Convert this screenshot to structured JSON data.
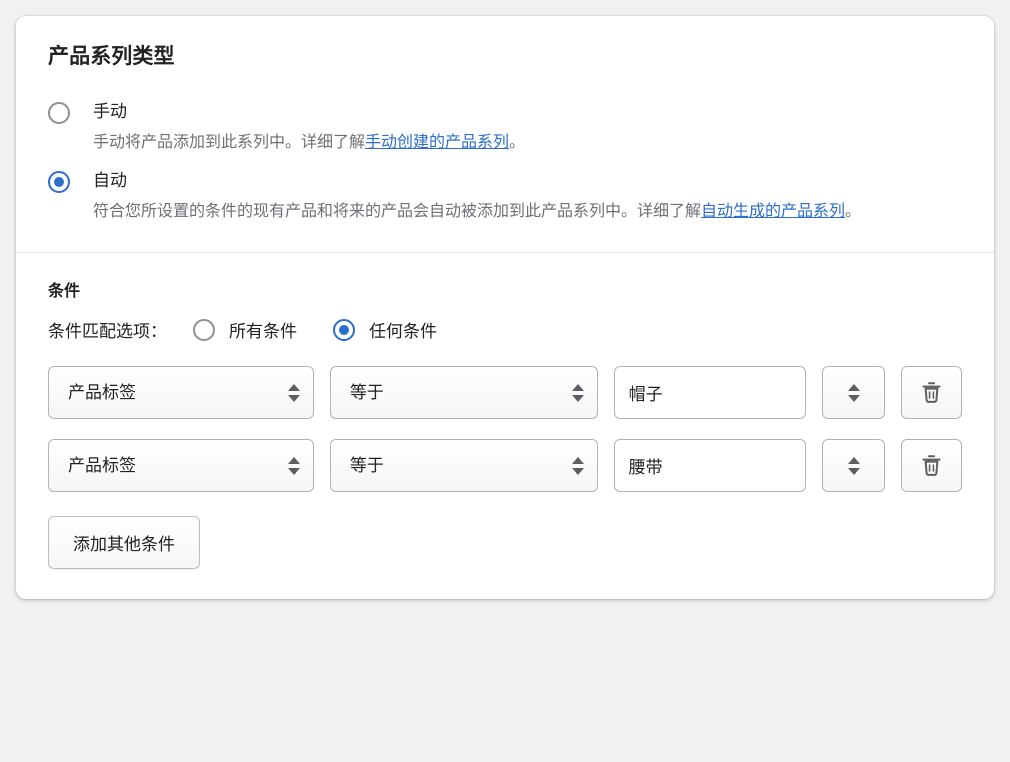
{
  "collection_type": {
    "title": "产品系列类型",
    "options": [
      {
        "label": "手动",
        "selected": false,
        "help_prefix": "手动将产品添加到此系列中。详细了解",
        "help_link": "手动创建的产品系列",
        "help_suffix": "。"
      },
      {
        "label": "自动",
        "selected": true,
        "help_prefix": "符合您所设置的条件的现有产品和将来的产品会自动被添加到此产品系列中。详细了解",
        "help_link": "自动生成的产品系列",
        "help_suffix": "。"
      }
    ]
  },
  "conditions": {
    "title": "条件",
    "match_label": "条件匹配选项：",
    "match_options": [
      {
        "label": "所有条件",
        "selected": false
      },
      {
        "label": "任何条件",
        "selected": true
      }
    ],
    "rows": [
      {
        "field": "产品标签",
        "operator": "等于",
        "value": "帽子",
        "value_placeholder": "",
        "stepper_icon": "stepper-icon",
        "delete_icon": "trash-icon"
      },
      {
        "field": "产品标签",
        "operator": "等于",
        "value": "腰带",
        "value_placeholder": "",
        "stepper_icon": "stepper-icon",
        "delete_icon": "trash-icon"
      }
    ],
    "add_button": "添加其他条件"
  },
  "colors": {
    "accent": "#2c6ecb",
    "link": "#2c6ecb",
    "text": "#202223",
    "muted": "#6d7175",
    "border": "#aeb4b9",
    "page_bg": "#f1f1f1",
    "card_bg": "#ffffff"
  }
}
